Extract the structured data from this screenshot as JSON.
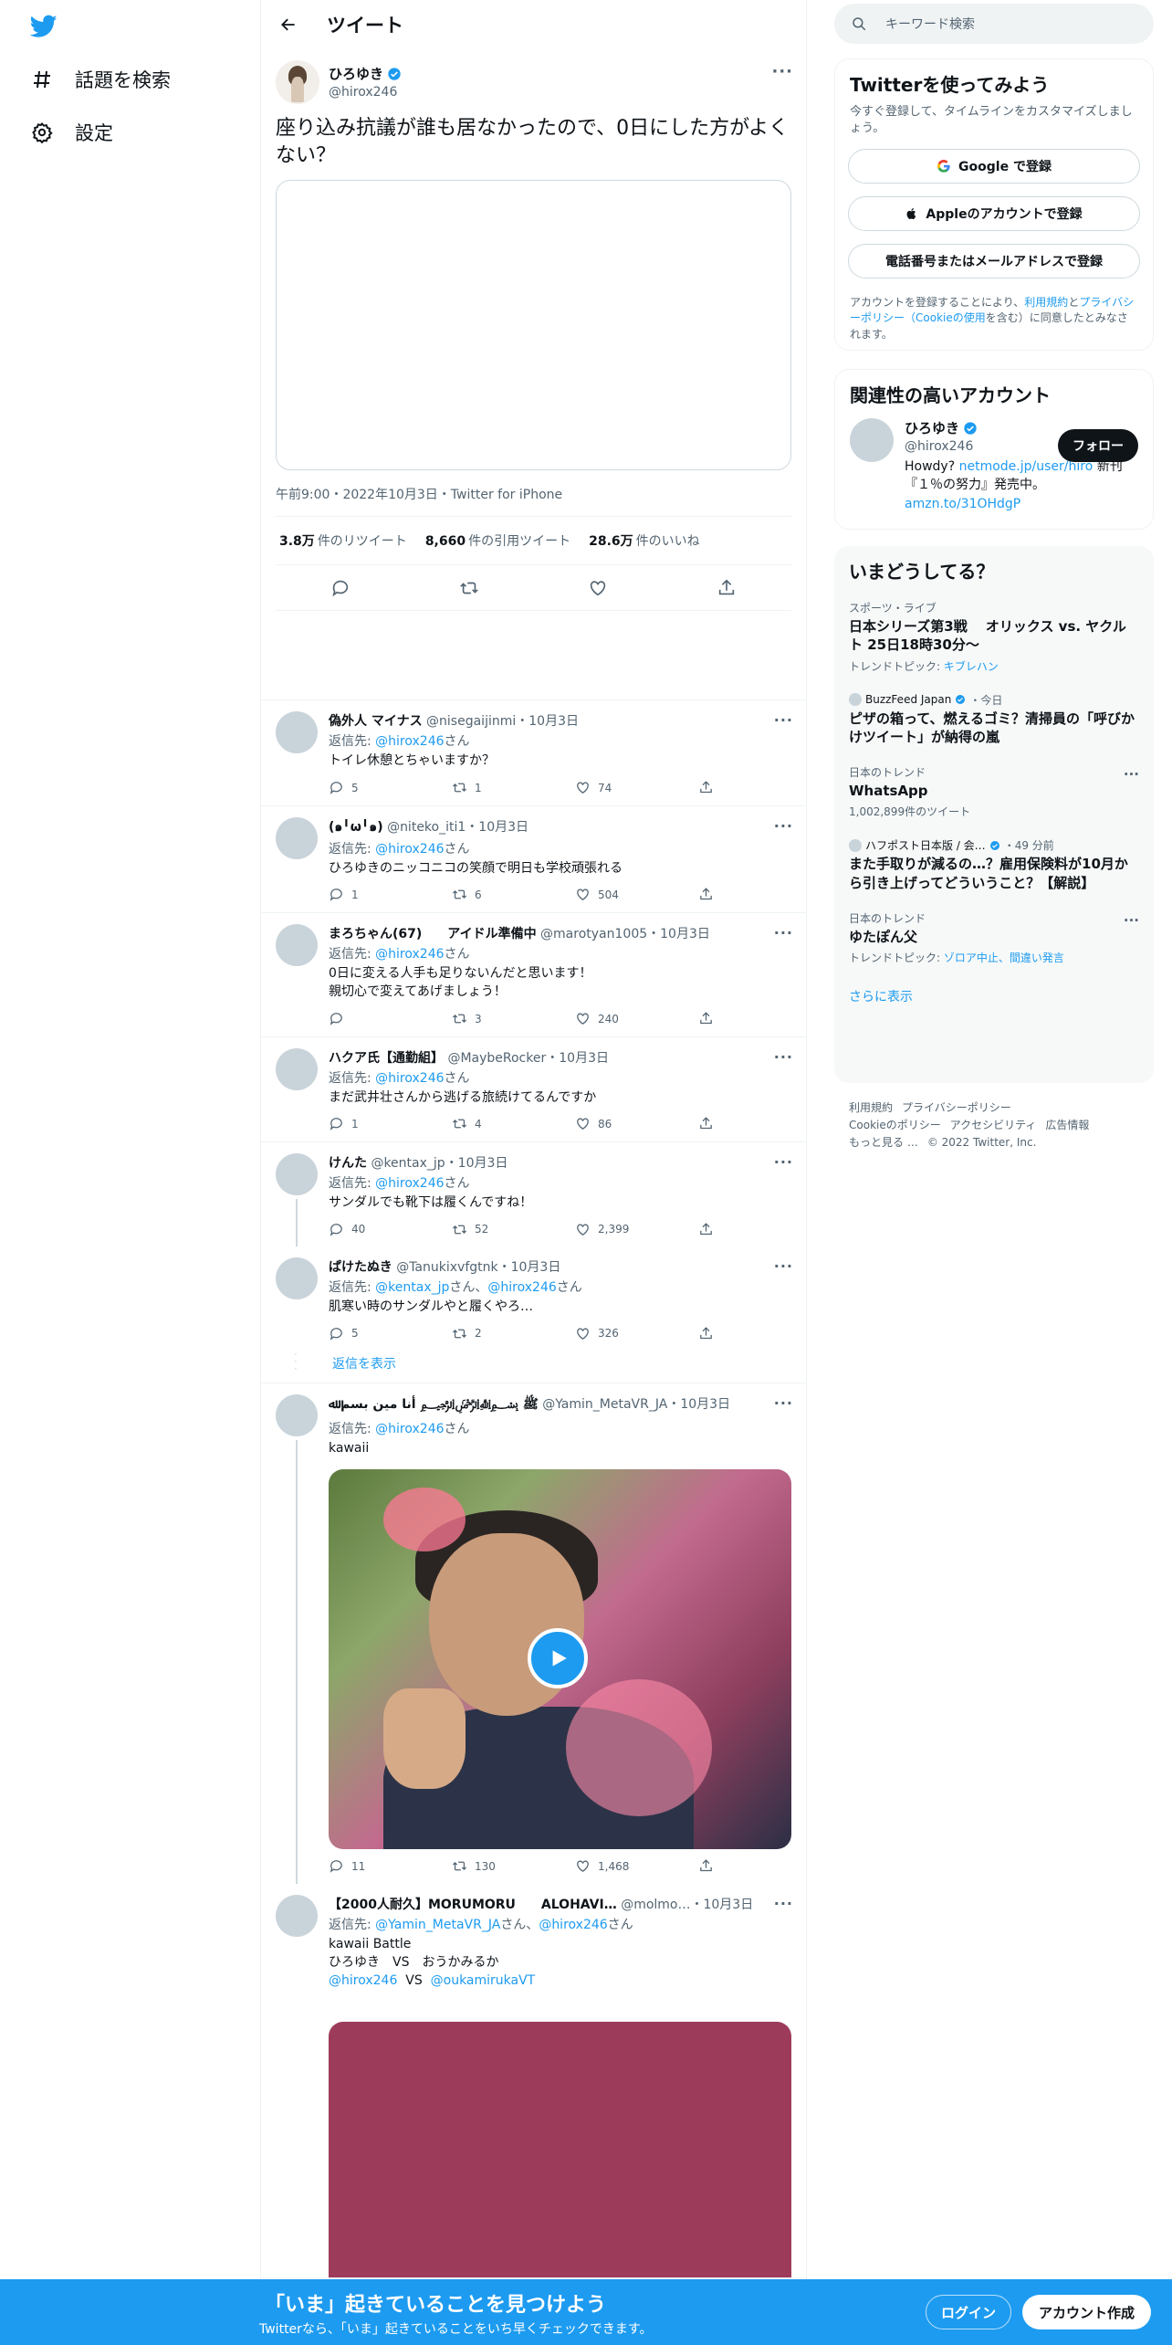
{
  "nav": {
    "explore_label": "話題を検索",
    "settings_label": "設定"
  },
  "header": {
    "title": "ツイート"
  },
  "main_tweet": {
    "name": "ひろゆき",
    "handle": "@hirox246",
    "text": "座り込み抗議が誰も居なかったので、0日にした方がよくない？",
    "meta": "午前9:00・2022年10月3日・Twitter for iPhone",
    "retweets_value": "3.8万",
    "retweets_label": "件のリツイート",
    "quotes_value": "8,660",
    "quotes_label": "件の引用ツイート",
    "likes_value": "28.6万",
    "likes_label": "件のいいね"
  },
  "replies": [
    {
      "name": "偽外人 マイナス",
      "handle": "@nisegaijinmi",
      "date": "・10月3日",
      "reply_prefix": "返信先: ",
      "reply_to": "@hirox246",
      "reply_suffix": "さん",
      "text": "トイレ休憩とちゃいますか？",
      "replies": "5",
      "retweets": "1",
      "likes": "74"
    },
    {
      "name": "(๑╹ω╹๑)",
      "handle": "@niteko_iti1",
      "date": "・10月3日",
      "reply_prefix": "返信先: ",
      "reply_to": "@hirox246",
      "reply_suffix": "さん",
      "text": "ひろゆきのニッコニコの笑顔で明日も学校頑張れる",
      "replies": "1",
      "retweets": "6",
      "likes": "504"
    },
    {
      "name": "まろちゃん(67)　　アイドル準備中",
      "handle": "@marotyan1005",
      "date": "・10月3日",
      "reply_prefix": "返信先: ",
      "reply_to": "@hirox246",
      "reply_suffix": "さん",
      "text": "0日に変える人手も足りないんだと思います！\n親切心で変えてあげましょう！",
      "replies": "",
      "retweets": "3",
      "likes": "240"
    },
    {
      "name": "ハクア氏【通勤組】",
      "handle": "@MaybeRocker",
      "date": "・10月3日",
      "reply_prefix": "返信先: ",
      "reply_to": "@hirox246",
      "reply_suffix": "さん",
      "text": "まだ武井壮さんから逃げる旅続けてるんですか",
      "replies": "1",
      "retweets": "4",
      "likes": "86"
    },
    {
      "name": "けんた",
      "handle": "@kentax_jp",
      "date": "・10月3日",
      "reply_prefix": "返信先: ",
      "reply_to": "@hirox246",
      "reply_suffix": "さん",
      "text": "サンダルでも靴下は履くんですね！",
      "replies": "40",
      "retweets": "52",
      "likes": "2,399"
    },
    {
      "name": "ぱけたぬき",
      "handle": "@Tanukixvfgtnk",
      "date": "・10月3日",
      "reply_prefix": "返信先: ",
      "reply_to": "@kentax_jp",
      "reply_mid": "さん、",
      "reply_to2": "@hirox246",
      "reply_suffix": "さん",
      "text": "肌寒い時のサンダルやと履くやろ…",
      "replies": "5",
      "retweets": "2",
      "likes": "326"
    },
    {
      "name": "ﷺ ﷽ أﻧﺎ مين ﺑﺴﻢ ﷲ",
      "handle": "@Yamin_MetaVR_JA",
      "date": "・10月3日",
      "reply_prefix": "返信先: ",
      "reply_to": "@hirox246",
      "reply_suffix": "さん",
      "text": "kawaii",
      "replies": "11",
      "retweets": "130",
      "likes": "1,468"
    },
    {
      "name": "【2000人耐久】MORUMORU　　ALOHAVI…",
      "handle": "@molmo…",
      "date": "・10月3日",
      "reply_prefix": "返信先: ",
      "reply_to": "@Yamin_MetaVR_JA",
      "reply_mid": "さん、",
      "reply_to2": "@hirox246",
      "reply_suffix": "さん",
      "text_line1": "kawaii Battle",
      "text_line2": "ひろゆき　VS　おうかみるか",
      "text_link1": "@hirox246",
      "text_vs": "  VS  ",
      "text_link2": "@oukamirukaVT"
    }
  ],
  "show_replies_label": "返信を表示",
  "right": {
    "search_placeholder": "キーワード検索",
    "signup": {
      "title": "Twitterを使ってみよう",
      "sub": "今すぐ登録して、タイムラインをカスタマイズしましょう。",
      "google": "Google で登録",
      "apple": "Appleのアカウントで登録",
      "phone": "電話番号またはメールアドレスで登録",
      "terms_1": "アカウントを登録することにより、",
      "terms_link1": "利用規約",
      "terms_2": "と",
      "terms_link2": "プライバシーポリシー（Cookieの使用",
      "terms_3": "を含む）に同意したとみなされます。"
    },
    "relevant": {
      "title": "関連性の高いアカウント",
      "name": "ひろゆき",
      "handle": "@hirox246",
      "follow": "フォロー",
      "bio_1": "Howdy? ",
      "bio_link1": "netmode.jp/user/hiro",
      "bio_2": " 新刊『１％の努力』発売中。",
      "bio_link2": "amzn.to/31OHdgP"
    },
    "trends": {
      "title": "いまどうしてる？",
      "items": [
        {
          "cat": "スポーツ・ライブ",
          "title": "日本シリーズ第3戦　 オリックス vs. ヤクルト 25日18時30分〜",
          "sub_label": "トレンドトピック: ",
          "sub_link": "キブレハン"
        },
        {
          "cat": "BuzzFeed Japan",
          "cat_suffix": "・今日",
          "title": "ピザの箱って、燃えるゴミ？清掃員の「呼びかけツイート」が納得の嵐"
        },
        {
          "cat": "日本のトレンド",
          "title": "WhatsApp",
          "sub": "1,002,899件のツイート"
        },
        {
          "cat": "ハフポスト日本版 / 会…",
          "cat_suffix": "・49 分前",
          "title": "また手取りが減るの…？雇用保険料が10月から引き上げってどういうこと？【解説】"
        },
        {
          "cat": "日本のトレンド",
          "title": "ゆたぽん父",
          "sub_label": "トレンドトピック: ",
          "sub_link": "ゾロア中止、間違い発言"
        }
      ],
      "show_more": "さらに表示"
    },
    "footer": {
      "l1": "利用規約",
      "l2": "プライバシーポリシー",
      "l3": "Cookieのポリシー",
      "l4": "アクセシビリティ",
      "l5": "広告情報",
      "l6": "もっと見る …",
      "l7": "© 2022 Twitter, Inc."
    }
  },
  "bottom": {
    "headline": "「いま」起きていることを見つけよう",
    "sub": "Twitterなら、「いま」起きていることをいち早くチェックできます。",
    "login": "ログイン",
    "signup": "アカウント作成"
  },
  "colors": {
    "brand": "#1d9bf0",
    "text": "#0f1419",
    "muted": "#536471"
  }
}
